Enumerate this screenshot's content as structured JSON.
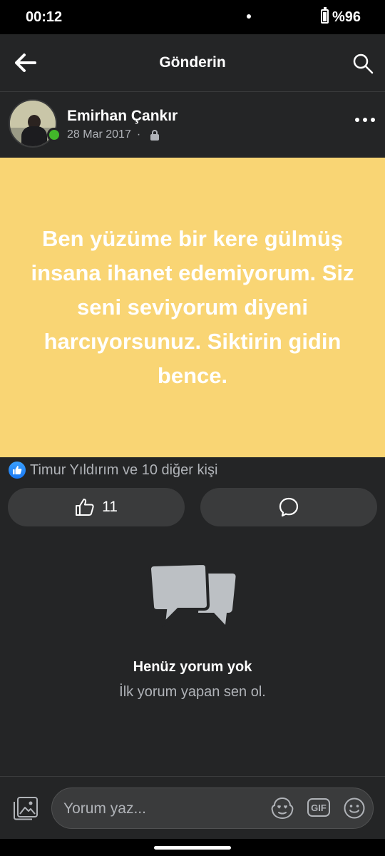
{
  "status_bar": {
    "time": "00:12",
    "battery": "%96"
  },
  "header": {
    "title": "Gönderin",
    "back_icon": "arrow-left-icon",
    "search_icon": "search-icon"
  },
  "post": {
    "author": "Emirhan Çankır",
    "date": "28 Mar 2017",
    "separator": "·",
    "privacy_icon": "lock-icon",
    "text": "Ben yüzüme bir kere gülmüş insana ihanet edemiyorum. Siz seni seviyorum diyeni harcıyorsunuz. Siktirin gidin bence.",
    "background_color": "#f9d574"
  },
  "reactions": {
    "summary": "Timur Yıldırım ve 10 diğer kişi",
    "icon": "like-badge-icon"
  },
  "actions": {
    "like_count": "11",
    "like_icon": "thumbs-up-icon",
    "comment_icon": "comment-icon"
  },
  "comments": {
    "empty_title": "Henüz yorum yok",
    "empty_subtitle": "İlk yorum yapan sen ol."
  },
  "composer": {
    "placeholder": "Yorum yaz...",
    "gif_label": "GIF"
  },
  "colors": {
    "background": "#242526",
    "surface": "#3a3b3c",
    "online": "#42b72a",
    "like_blue": "#1877f2"
  }
}
